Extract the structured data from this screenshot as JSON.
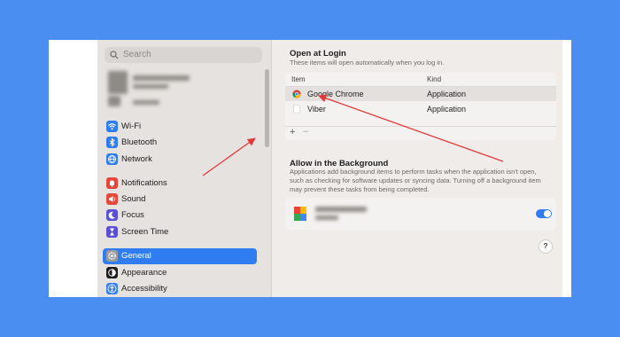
{
  "sidebar": {
    "search_placeholder": "Search",
    "items": [
      {
        "label": "Wi-Fi",
        "icon": "wifi-icon",
        "color": "#2f7df1"
      },
      {
        "label": "Bluetooth",
        "icon": "bluetooth-icon",
        "color": "#2f7df1"
      },
      {
        "label": "Network",
        "icon": "network-globe-icon",
        "color": "#2f7df1"
      },
      {
        "label": "Notifications",
        "icon": "notifications-bell-icon",
        "color": "#e5483b"
      },
      {
        "label": "Sound",
        "icon": "speaker-icon",
        "color": "#e5483b"
      },
      {
        "label": "Focus",
        "icon": "moon-icon",
        "color": "#5b4fd6"
      },
      {
        "label": "Screen Time",
        "icon": "hourglass-icon",
        "color": "#5b4fd6"
      },
      {
        "label": "General",
        "icon": "gear-icon",
        "color": "#8e8e93",
        "active": true
      },
      {
        "label": "Appearance",
        "icon": "appearance-icon",
        "color": "#1c1c1c"
      },
      {
        "label": "Accessibility",
        "icon": "accessibility-icon",
        "color": "#2f7df1"
      }
    ]
  },
  "login": {
    "title": "Open at Login",
    "subtitle": "These items will open automatically when you log in.",
    "col_item": "Item",
    "col_kind": "Kind",
    "rows": [
      {
        "item": "Google Chrome",
        "kind": "Application",
        "icon": "chrome-icon"
      },
      {
        "item": "Viber",
        "kind": "Application",
        "icon": "file-icon"
      }
    ],
    "add": "+",
    "remove": "–"
  },
  "background": {
    "title": "Allow in the Background",
    "description": "Applications add background items to perform tasks when the application isn't open, such as checking for software updates or syncing data. Turning off a background item may prevent these tasks from being completed.",
    "toggle_on": true
  },
  "help": "?",
  "accent": "#2f7df1",
  "annotation_color": "#e23a3a"
}
